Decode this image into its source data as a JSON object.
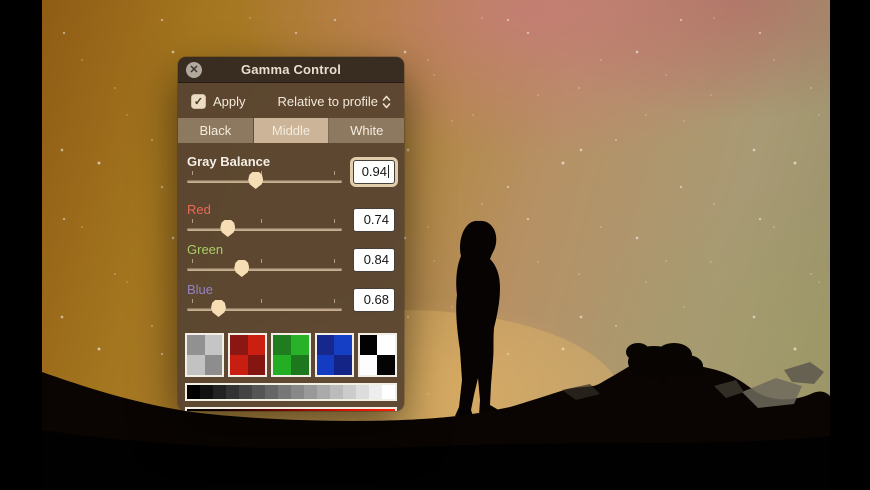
{
  "window": {
    "title": "Gamma Control",
    "close_label": "✕"
  },
  "controls": {
    "apply_label": "Apply",
    "apply_checked": true,
    "check_glyph": "✓",
    "profile_popup_value": "Relative to profile"
  },
  "tabs": [
    {
      "label": "Black",
      "active": false
    },
    {
      "label": "Middle",
      "active": true
    },
    {
      "label": "White",
      "active": false
    }
  ],
  "tab_colors": {
    "active_bg": "#cbb497",
    "inactive_bg": "#8d7860"
  },
  "sliders": [
    {
      "id": "gray-balance",
      "label": "Gray Balance",
      "value": "0.94",
      "label_color": "#f4efe6",
      "position": 0.44,
      "focused": true,
      "emphasis": true
    },
    {
      "id": "red",
      "label": "Red",
      "value": "0.74",
      "label_color": "#e86a57",
      "position": 0.26,
      "focused": false,
      "emphasis": false
    },
    {
      "id": "green",
      "label": "Green",
      "value": "0.84",
      "label_color": "#a9cf66",
      "position": 0.35,
      "focused": false,
      "emphasis": false
    },
    {
      "id": "blue",
      "label": "Blue",
      "value": "0.68",
      "label_color": "#9582c5",
      "position": 0.2,
      "focused": false,
      "emphasis": false
    }
  ],
  "swatches": [
    {
      "name": "gray",
      "dither": true,
      "quadrants": [
        "#919191",
        "#c5c5c5",
        "#c2c2c2",
        "#8d8d8d"
      ]
    },
    {
      "name": "red",
      "dither": true,
      "quadrants": [
        "#8a1712",
        "#cb1f12",
        "#c81e11",
        "#851511"
      ]
    },
    {
      "name": "green",
      "dither": true,
      "quadrants": [
        "#1f7d1f",
        "#27b227",
        "#24ae24",
        "#1d781d"
      ]
    },
    {
      "name": "blue",
      "dither": true,
      "quadrants": [
        "#16288c",
        "#1540c6",
        "#143cc2",
        "#142486"
      ]
    },
    {
      "name": "black-white",
      "dither": false,
      "quadrants": [
        "#020202",
        "#ffffff",
        "#fdfdfd",
        "#040404"
      ]
    }
  ],
  "strips": [
    {
      "name": "grayscale-ramp"
    },
    {
      "name": "rgb-ramp"
    }
  ]
}
